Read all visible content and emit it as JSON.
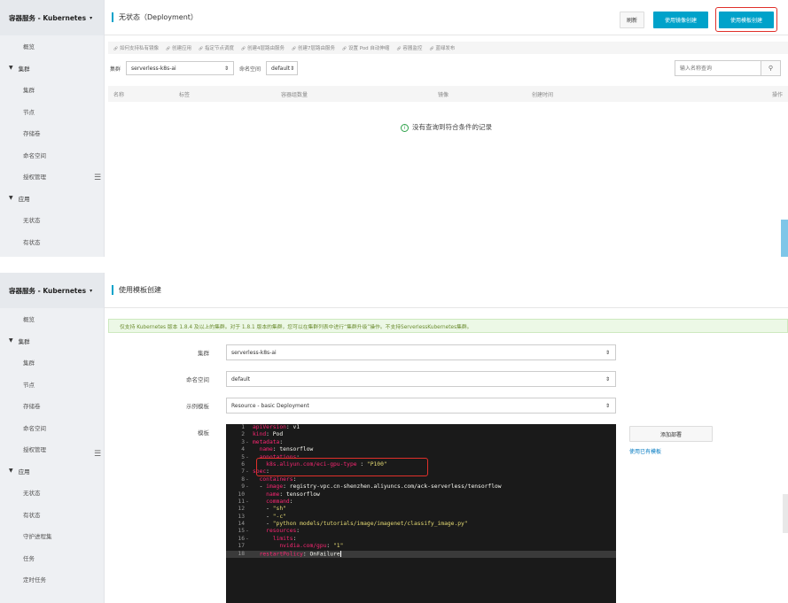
{
  "panel1": {
    "sidebar": {
      "header": "容器服务 - Kubernetes",
      "items": [
        {
          "label": "概览",
          "type": "item"
        },
        {
          "label": "集群",
          "type": "group"
        },
        {
          "label": "集群",
          "type": "item"
        },
        {
          "label": "节点",
          "type": "item"
        },
        {
          "label": "存储卷",
          "type": "item"
        },
        {
          "label": "命名空间",
          "type": "item"
        },
        {
          "label": "授权管理",
          "type": "item"
        },
        {
          "label": "应用",
          "type": "group"
        },
        {
          "label": "无状态",
          "type": "item"
        },
        {
          "label": "有状态",
          "type": "item"
        }
      ]
    },
    "title": "无状态（Deployment）",
    "buttons": {
      "refresh": "刷新",
      "image_create": "使用镜像创建",
      "template_create": "使用模板创建"
    },
    "links": [
      "如何支持私有镜像",
      "创建应用",
      "指定节点调度",
      "创建4层路由服务",
      "创建7层路由服务",
      "设置 Pod 自动伸缩",
      "容器监控",
      "蓝绿发布"
    ],
    "filter": {
      "cluster_label": "集群",
      "cluster_value": "serverless-k8s-ai",
      "namespace_label": "命名空间",
      "namespace_value": "default",
      "search_placeholder": "输入名称查询"
    },
    "table_headers": [
      "名称",
      "标签",
      "容器组数量",
      "镜像",
      "创建时间",
      "操作"
    ],
    "empty_message": "没有查询到符合条件的记录"
  },
  "panel2": {
    "sidebar": {
      "header": "容器服务 - Kubernetes",
      "items": [
        {
          "label": "概览",
          "type": "item"
        },
        {
          "label": "集群",
          "type": "group"
        },
        {
          "label": "集群",
          "type": "item"
        },
        {
          "label": "节点",
          "type": "item"
        },
        {
          "label": "存储卷",
          "type": "item"
        },
        {
          "label": "命名空间",
          "type": "item"
        },
        {
          "label": "授权管理",
          "type": "item"
        },
        {
          "label": "应用",
          "type": "group"
        },
        {
          "label": "无状态",
          "type": "item"
        },
        {
          "label": "有状态",
          "type": "item"
        },
        {
          "label": "守护进程集",
          "type": "item"
        },
        {
          "label": "任务",
          "type": "item"
        },
        {
          "label": "定时任务",
          "type": "item"
        }
      ]
    },
    "title": "使用模板创建",
    "notice": "仅支持 Kubernetes 版本 1.8.4 及以上的集群。对于 1.8.1 版本的集群，您可以在集群列表中进行“集群升级”操作。不支持ServerlessKubernetes集群。",
    "form": {
      "cluster_label": "集群",
      "cluster_value": "serverless-k8s-ai",
      "namespace_label": "命名空间",
      "namespace_value": "default",
      "sample_label": "示例模板",
      "sample_value": "Resource - basic Deployment",
      "template_label": "模板"
    },
    "add_deploy": "添加部署",
    "use_existing": "使用已有模板",
    "code_lines": [
      {
        "n": "1",
        "fold": "",
        "parts": [
          [
            "k",
            "apiVersion"
          ],
          [
            "p",
            ": "
          ],
          [
            "p",
            "v1"
          ]
        ]
      },
      {
        "n": "2",
        "fold": "",
        "parts": [
          [
            "k",
            "kind"
          ],
          [
            "p",
            ": "
          ],
          [
            "p",
            "Pod"
          ]
        ]
      },
      {
        "n": "3",
        "fold": "-",
        "parts": [
          [
            "k",
            "metadata"
          ],
          [
            "p",
            ":"
          ]
        ]
      },
      {
        "n": "4",
        "fold": "",
        "parts": [
          [
            "p",
            "  "
          ],
          [
            "k",
            "name"
          ],
          [
            "p",
            ": "
          ],
          [
            "p",
            "tensorflow"
          ]
        ]
      },
      {
        "n": "5",
        "fold": "-",
        "parts": [
          [
            "p",
            "  "
          ],
          [
            "k",
            "annotations"
          ],
          [
            "p",
            ":"
          ]
        ]
      },
      {
        "n": "6",
        "fold": "",
        "parts": [
          [
            "p",
            "    "
          ],
          [
            "k",
            "k8s.aliyun.com/eci-gpu-type"
          ],
          [
            "p",
            " : "
          ],
          [
            "s",
            "\"P100\""
          ]
        ]
      },
      {
        "n": "7",
        "fold": "-",
        "parts": [
          [
            "k",
            "spec"
          ],
          [
            "p",
            ":"
          ]
        ]
      },
      {
        "n": "8",
        "fold": "-",
        "parts": [
          [
            "p",
            "  "
          ],
          [
            "k",
            "containers"
          ],
          [
            "p",
            ":"
          ]
        ]
      },
      {
        "n": "9",
        "fold": "-",
        "parts": [
          [
            "p",
            "  - "
          ],
          [
            "k",
            "image"
          ],
          [
            "p",
            ": "
          ],
          [
            "p",
            "registry-vpc.cn-shenzhen.aliyuncs.com/ack-serverless/tensorflow"
          ]
        ]
      },
      {
        "n": "10",
        "fold": "",
        "parts": [
          [
            "p",
            "    "
          ],
          [
            "k",
            "name"
          ],
          [
            "p",
            ": "
          ],
          [
            "p",
            "tensorflow"
          ]
        ]
      },
      {
        "n": "11",
        "fold": "-",
        "parts": [
          [
            "p",
            "    "
          ],
          [
            "k",
            "command"
          ],
          [
            "p",
            ":"
          ]
        ]
      },
      {
        "n": "12",
        "fold": "",
        "parts": [
          [
            "p",
            "    - "
          ],
          [
            "s",
            "\"sh\""
          ]
        ]
      },
      {
        "n": "13",
        "fold": "",
        "parts": [
          [
            "p",
            "    - "
          ],
          [
            "s",
            "\"-c\""
          ]
        ]
      },
      {
        "n": "14",
        "fold": "",
        "parts": [
          [
            "p",
            "    - "
          ],
          [
            "s",
            "\"python models/tutorials/image/imagenet/classify_image.py\""
          ]
        ]
      },
      {
        "n": "15",
        "fold": "-",
        "parts": [
          [
            "p",
            "    "
          ],
          [
            "k",
            "resources"
          ],
          [
            "p",
            ":"
          ]
        ]
      },
      {
        "n": "16",
        "fold": "-",
        "parts": [
          [
            "p",
            "      "
          ],
          [
            "k",
            "limits"
          ],
          [
            "p",
            ":"
          ]
        ]
      },
      {
        "n": "17",
        "fold": "",
        "parts": [
          [
            "p",
            "        "
          ],
          [
            "k",
            "nvidia.com/gpu"
          ],
          [
            "p",
            ": "
          ],
          [
            "s",
            "\"1\""
          ]
        ]
      },
      {
        "n": "18",
        "fold": "",
        "parts": [
          [
            "p",
            "  "
          ],
          [
            "k",
            "restartPolicy"
          ],
          [
            "p",
            ": "
          ],
          [
            "p",
            "OnFailure"
          ]
        ]
      }
    ]
  },
  "colors": {
    "accent": "#00a2ca",
    "highlight": "#e0302a",
    "notice_bg": "#ecf8e6",
    "editor_bg": "#1a1a1a"
  },
  "icons": {
    "search": "search-icon",
    "info": "info-icon",
    "link": "link-icon",
    "caret": "caret-down-icon",
    "collapse": "collapse-sidebar-icon"
  }
}
